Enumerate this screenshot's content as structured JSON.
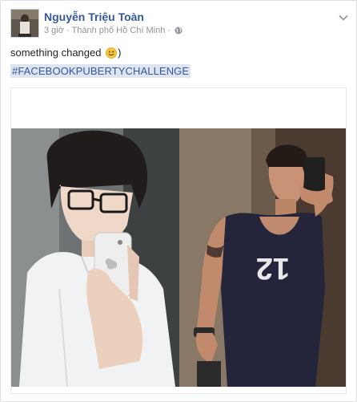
{
  "post": {
    "author_name": "Nguyễn Triệu Toàn",
    "time": "3 giờ",
    "separator": " · ",
    "location": "Thành phố Hồ Chí Minh",
    "privacy_icon": "globe-icon",
    "menu_icon": "chevron-down-icon",
    "text_before_emoji": "something changed ",
    "emoji": "smiley-emoji",
    "text_after_emoji": ")",
    "hashtag": "#FACEBOOKPUBERTYCHALLENGE",
    "photo": {
      "left_jersey_text": "",
      "right_jersey_number": "12"
    }
  },
  "colors": {
    "author_link": "#365899",
    "meta_text": "#90949c",
    "hashtag_bg": "#dee4f0",
    "card_border": "#dddfe2"
  }
}
